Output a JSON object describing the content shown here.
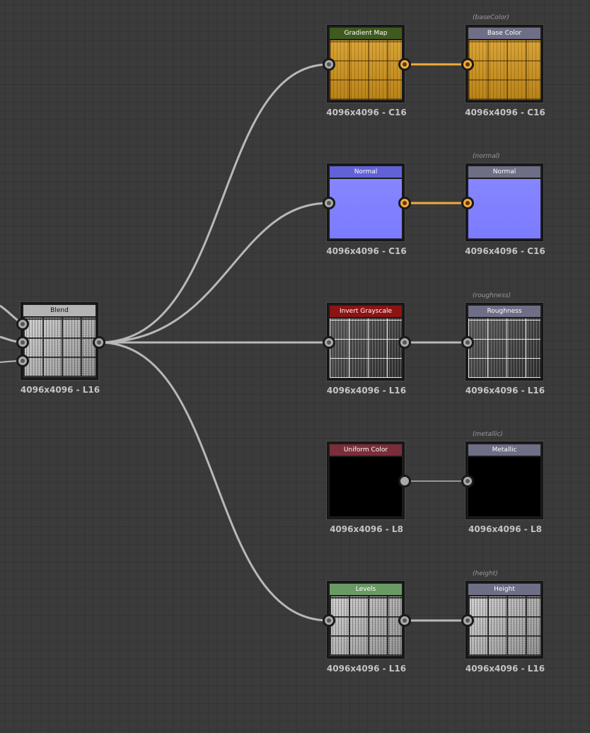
{
  "colors": {
    "canvas": "#3b3b3b",
    "wire_gray": "#b8b8b8",
    "wire_orange": "#f2a93b",
    "header_gradient_map": "#3f5a1e",
    "header_normal": "#6262d8",
    "header_invert": "#8e1313",
    "header_uniform": "#7a2e3a",
    "header_levels": "#6a9a64",
    "header_output": "#6e6e86",
    "header_blend": "#b4b4b4"
  },
  "nodes": {
    "blend": {
      "title": "Blend",
      "resolution": "4096x4096 - L16"
    },
    "gradient_map": {
      "title": "Gradient Map",
      "resolution": "4096x4096 - C16"
    },
    "base_color": {
      "title": "Base Color",
      "resolution": "4096x4096 - C16",
      "tag": "(baseColor)"
    },
    "normal_filter": {
      "title": "Normal",
      "resolution": "4096x4096 - C16"
    },
    "normal_output": {
      "title": "Normal",
      "resolution": "4096x4096 - C16",
      "tag": "(normal)"
    },
    "invert_grayscale": {
      "title": "Invert Grayscale",
      "resolution": "4096x4096 - L16"
    },
    "roughness": {
      "title": "Roughness",
      "resolution": "4096x4096 - L16",
      "tag": "(roughness)"
    },
    "uniform_color": {
      "title": "Uniform Color",
      "resolution": "4096x4096 - L8"
    },
    "metallic": {
      "title": "Metallic",
      "resolution": "4096x4096 - L8",
      "tag": "(metallic)"
    },
    "levels": {
      "title": "Levels",
      "resolution": "4096x4096 - L16"
    },
    "height": {
      "title": "Height",
      "resolution": "4096x4096 - L16",
      "tag": "(height)"
    }
  }
}
